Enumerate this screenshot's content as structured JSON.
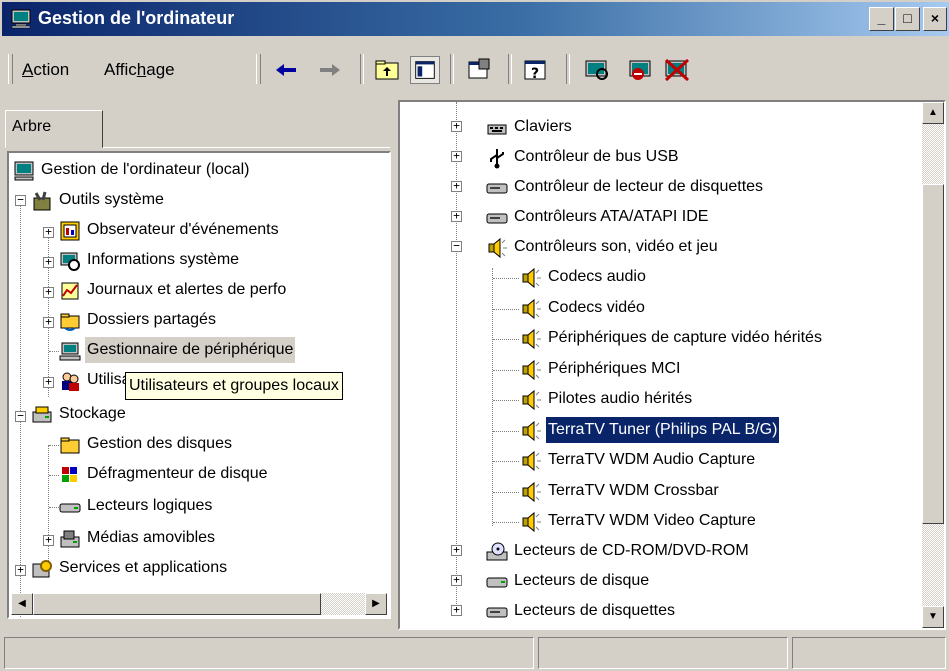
{
  "window": {
    "title": "Gestion de l'ordinateur"
  },
  "titlebar_buttons": {
    "minimize": "_",
    "maximize": "□",
    "close": "×"
  },
  "menu": {
    "action": "Action",
    "action_underline": "A",
    "action_rest": "ction",
    "affichage_pre": "Affic",
    "affichage_u": "h",
    "affichage_post": "age"
  },
  "toolbar": [
    "back-arrow-icon",
    "forward-arrow-icon",
    "up-folder-icon",
    "show-hide-tree-icon",
    "properties-icon",
    "help-icon",
    "scan-hardware-icon",
    "disable-device-icon",
    "uninstall-device-icon"
  ],
  "left": {
    "tab_label": "Arbre",
    "tree": {
      "root": "Gestion de l'ordinateur (local)",
      "outils": "Outils système",
      "observateur": "Observateur d'événements",
      "infos": "Informations système",
      "journaux": "Journaux et alertes de perfo",
      "dossiers": "Dossiers partagés",
      "gestionnaire": "Gestionnaire de périphérique",
      "utilisateurs": "Utilisateurs et groupes locaux",
      "stockage": "Stockage",
      "gestion_disques": "Gestion des disques",
      "defrag": "Défragmenteur de disque",
      "lecteurs_logiques": "Lecteurs logiques",
      "medias": "Médias amovibles",
      "services": "Services et applications"
    },
    "tooltip": "Utilisateurs et groupes locaux"
  },
  "right": {
    "claviers": "Claviers",
    "usb": "Contrôleur de bus USB",
    "disquettes_ctrl": "Contrôleur de lecteur de disquettes",
    "ata": "Contrôleurs ATA/ATAPI IDE",
    "son": "Contrôleurs son, vidéo et jeu",
    "children": [
      "Codecs audio",
      "Codecs vidéo",
      "Périphériques de capture vidéo hérités",
      "Périphériques MCI",
      "Pilotes audio hérités",
      "TerraTV Tuner (Philips PAL B/G)",
      "TerraTV WDM Audio Capture",
      "TerraTV WDM Crossbar",
      "TerraTV WDM Video Capture"
    ],
    "cdrom": "Lecteurs de CD-ROM/DVD-ROM",
    "disque": "Lecteurs de disque",
    "disquettes": "Lecteurs de disquettes",
    "selected_index": 5
  },
  "colors": {
    "titlebar_start": "#0a246a",
    "titlebar_end": "#a6caf0",
    "selection": "#0a246a",
    "face": "#d4d0c8",
    "tooltip_bg": "#ffffe1"
  }
}
